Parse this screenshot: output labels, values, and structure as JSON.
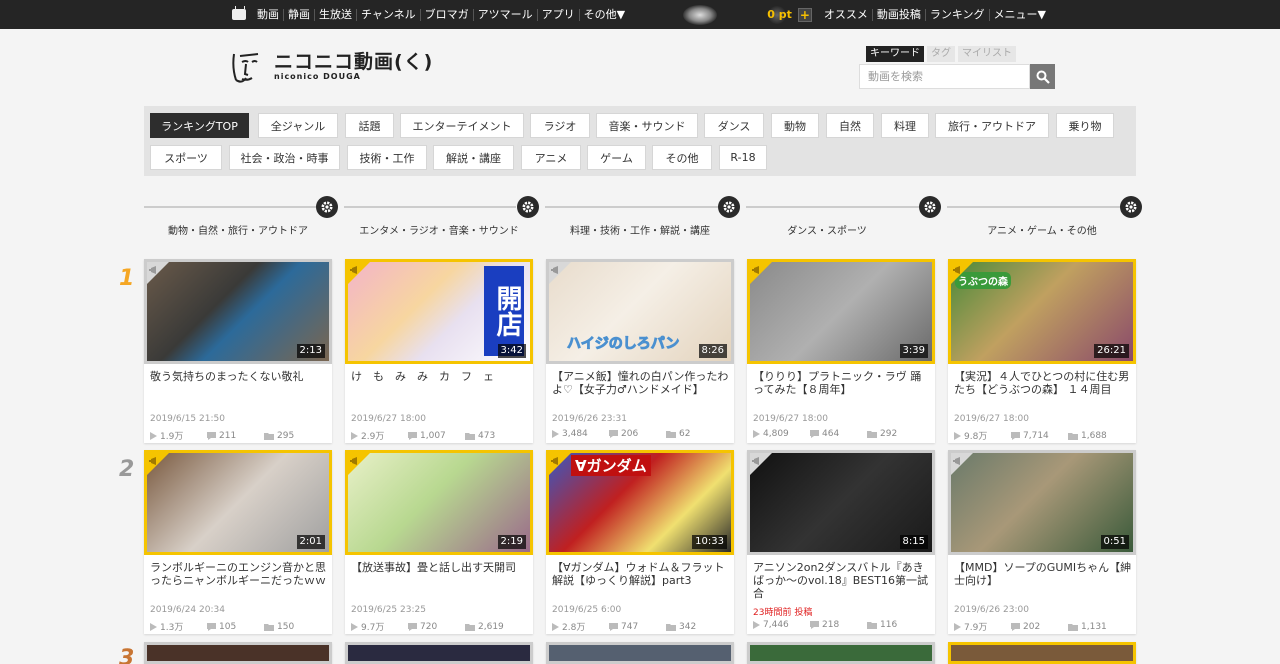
{
  "topbar": {
    "left_links": [
      "動画",
      "静画",
      "生放送",
      "チャンネル",
      "ブロマガ",
      "アツマール",
      "アプリ",
      "その他▼"
    ],
    "points": "0 pt",
    "plus": "+",
    "right_links": [
      "オススメ",
      "動画投稿",
      "ランキング",
      "メニュー▼"
    ]
  },
  "logo": {
    "main": "ニコニコ動画(く)",
    "sub": "niconico DOUGA"
  },
  "search": {
    "tabs": [
      "キーワード",
      "タグ",
      "マイリスト"
    ],
    "placeholder": "動画を検索"
  },
  "genres": [
    "ランキングTOP",
    "全ジャンル",
    "話題",
    "エンターテイメント",
    "ラジオ",
    "音楽・サウンド",
    "ダンス",
    "動物",
    "自然",
    "料理",
    "旅行・アウトドア",
    "乗り物",
    "スポーツ",
    "社会・政治・時事",
    "技術・工作",
    "解説・講座",
    "アニメ",
    "ゲーム",
    "その他",
    "R-18"
  ],
  "categories": [
    "動物・自然・旅行・アウトドア",
    "エンタメ・ラジオ・音楽・サウンド",
    "料理・技術・工作・解説・講座",
    "ダンス・スポーツ",
    "アニメ・ゲーム・その他"
  ],
  "ranks": [
    "1",
    "2",
    "3"
  ],
  "colors": {
    "rank1": "#f5a623",
    "rank2": "#999999",
    "rank3": "#c87533",
    "gold_border": "#f5c400",
    "new_red": "#e02020"
  },
  "rows": [
    [
      {
        "title": "敬う気持ちのまったくない敬礼",
        "duration": "2:13",
        "date": "2019/6/15 21:50",
        "views": "1.9万",
        "comments": "211",
        "mylists": "295",
        "frame": "gray"
      },
      {
        "title": "け　も　み　み　カ　フ　ェ",
        "duration": "3:42",
        "date": "2019/6/27 18:00",
        "views": "2.9万",
        "comments": "1,007",
        "mylists": "473",
        "frame": "gold",
        "thumb_text": "開店"
      },
      {
        "title": "【アニメ飯】憧れの白パン作ったわよ♡【女子力♂ハンドメイド】",
        "duration": "8:26",
        "date": "2019/6/26 23:31",
        "views": "3,484",
        "comments": "206",
        "mylists": "62",
        "frame": "gray",
        "thumb_text": "ハイジのしろパン"
      },
      {
        "title": "【りりり】プラトニック・ラヴ 踊ってみた【８周年】",
        "duration": "3:39",
        "date": "2019/6/27 18:00",
        "views": "4,809",
        "comments": "464",
        "mylists": "292",
        "frame": "gold"
      },
      {
        "title": "【実況】４人でひとつの村に住む男たち【どうぶつの森】 １４周目",
        "duration": "26:21",
        "date": "2019/6/27 18:00",
        "views": "9.8万",
        "comments": "7,714",
        "mylists": "1,688",
        "frame": "gold",
        "thumb_text": "うぶつの森"
      }
    ],
    [
      {
        "title": "ランボルギーニのエンジン音かと思ったらニャンボルギーニだったｗｗ",
        "duration": "2:01",
        "date": "2019/6/24 20:34",
        "views": "1.3万",
        "comments": "105",
        "mylists": "150",
        "frame": "gold"
      },
      {
        "title": "【放送事故】畳と話し出す天開司",
        "duration": "2:19",
        "date": "2019/6/25 23:25",
        "views": "9.7万",
        "comments": "720",
        "mylists": "2,619",
        "frame": "gold"
      },
      {
        "title": "【∀ガンダム】ウォドム＆フラット解説【ゆっくり解説】part3",
        "duration": "10:33",
        "date": "2019/6/25 6:00",
        "views": "2.8万",
        "comments": "747",
        "mylists": "342",
        "frame": "gold",
        "thumb_text": "∀ガンダム"
      },
      {
        "title": "アニソン2on2ダンスバトル『あきばっか～のvol.18』BEST16第一試合",
        "duration": "8:15",
        "date": "23時間前 投稿",
        "date_new": true,
        "views": "7,446",
        "comments": "218",
        "mylists": "116",
        "frame": "gray"
      },
      {
        "title": "【MMD】ソープのGUMIちゃん【紳士向け】",
        "duration": "0:51",
        "date": "2019/6/26 23:00",
        "views": "7.9万",
        "comments": "202",
        "mylists": "1,131",
        "frame": "gray"
      }
    ]
  ]
}
